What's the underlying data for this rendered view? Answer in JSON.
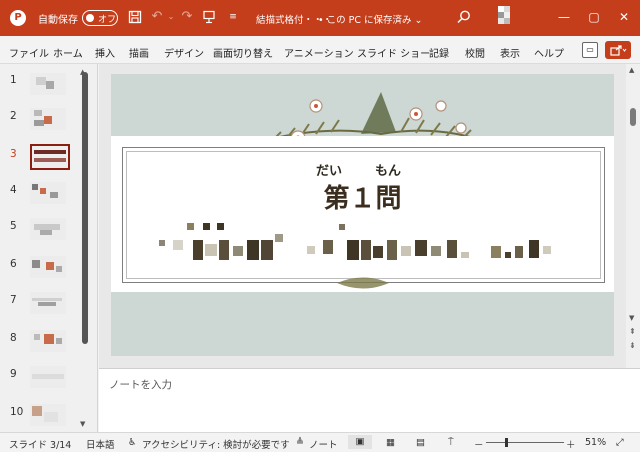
{
  "titlebar": {
    "logo_letter": "P",
    "autosave_label": "自動保存",
    "toggle_state": "オフ",
    "doc_name": "結描式格付・・・",
    "save_status": "• この PC に保存済み ⌄",
    "minimize": "—",
    "maximize": "▢",
    "close": "✕"
  },
  "ribbon": {
    "tabs": [
      "ファイル",
      "ホーム",
      "挿入",
      "描画",
      "デザイン",
      "画面切り替え",
      "アニメーション",
      "スライド ショー",
      "記録",
      "校閲",
      "表示",
      "ヘルプ"
    ]
  },
  "thumbnails": {
    "numbers": [
      "1",
      "2",
      "3",
      "4",
      "5",
      "6",
      "7",
      "8",
      "9",
      "10"
    ],
    "active_index": 3
  },
  "slide": {
    "furigana_left": "だい",
    "furigana_right": "もん",
    "title": "第１問"
  },
  "notes": {
    "placeholder": "ノートを入力"
  },
  "status": {
    "slide_info": "スライド 3/14",
    "language": "日本語",
    "accessibility": "アクセシビリティ: 検討が必要です",
    "notes_button": "ノート",
    "zoom_minus": "－",
    "zoom_plus": "＋",
    "zoom_level": "51%"
  },
  "colors": {
    "accent": "#c43e1c",
    "slide_bg": "#cdd8d5",
    "title_text": "#3b2e1e"
  }
}
